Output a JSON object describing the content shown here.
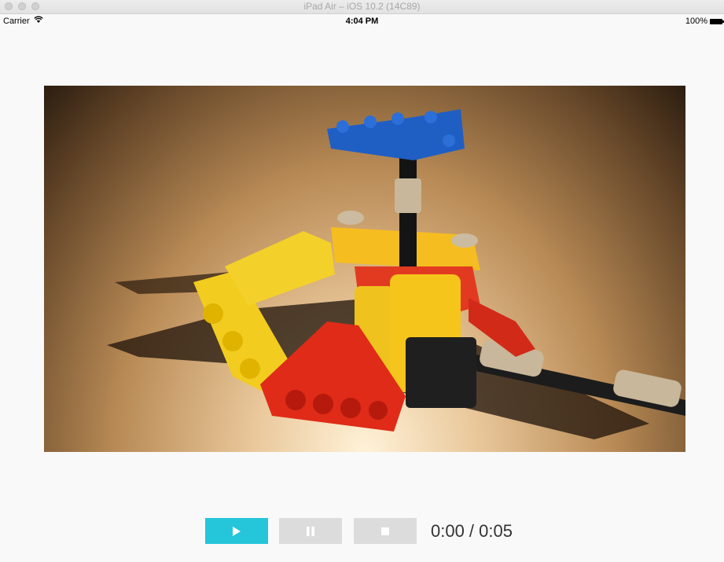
{
  "window": {
    "title": "iPad Air – iOS 10.2 (14C89)"
  },
  "status_bar": {
    "carrier": "Carrier",
    "time": "4:04 PM",
    "battery": "100%"
  },
  "player": {
    "video_subject": "Lego Technic helicopter model",
    "time_display": "0:00 / 0:05",
    "current_time": "0:00",
    "duration": "0:05",
    "accent_color": "#26c6da",
    "buttons": [
      {
        "name": "play",
        "icon": "play-icon"
      },
      {
        "name": "pause",
        "icon": "pause-icon"
      },
      {
        "name": "stop",
        "icon": "stop-icon"
      }
    ]
  }
}
